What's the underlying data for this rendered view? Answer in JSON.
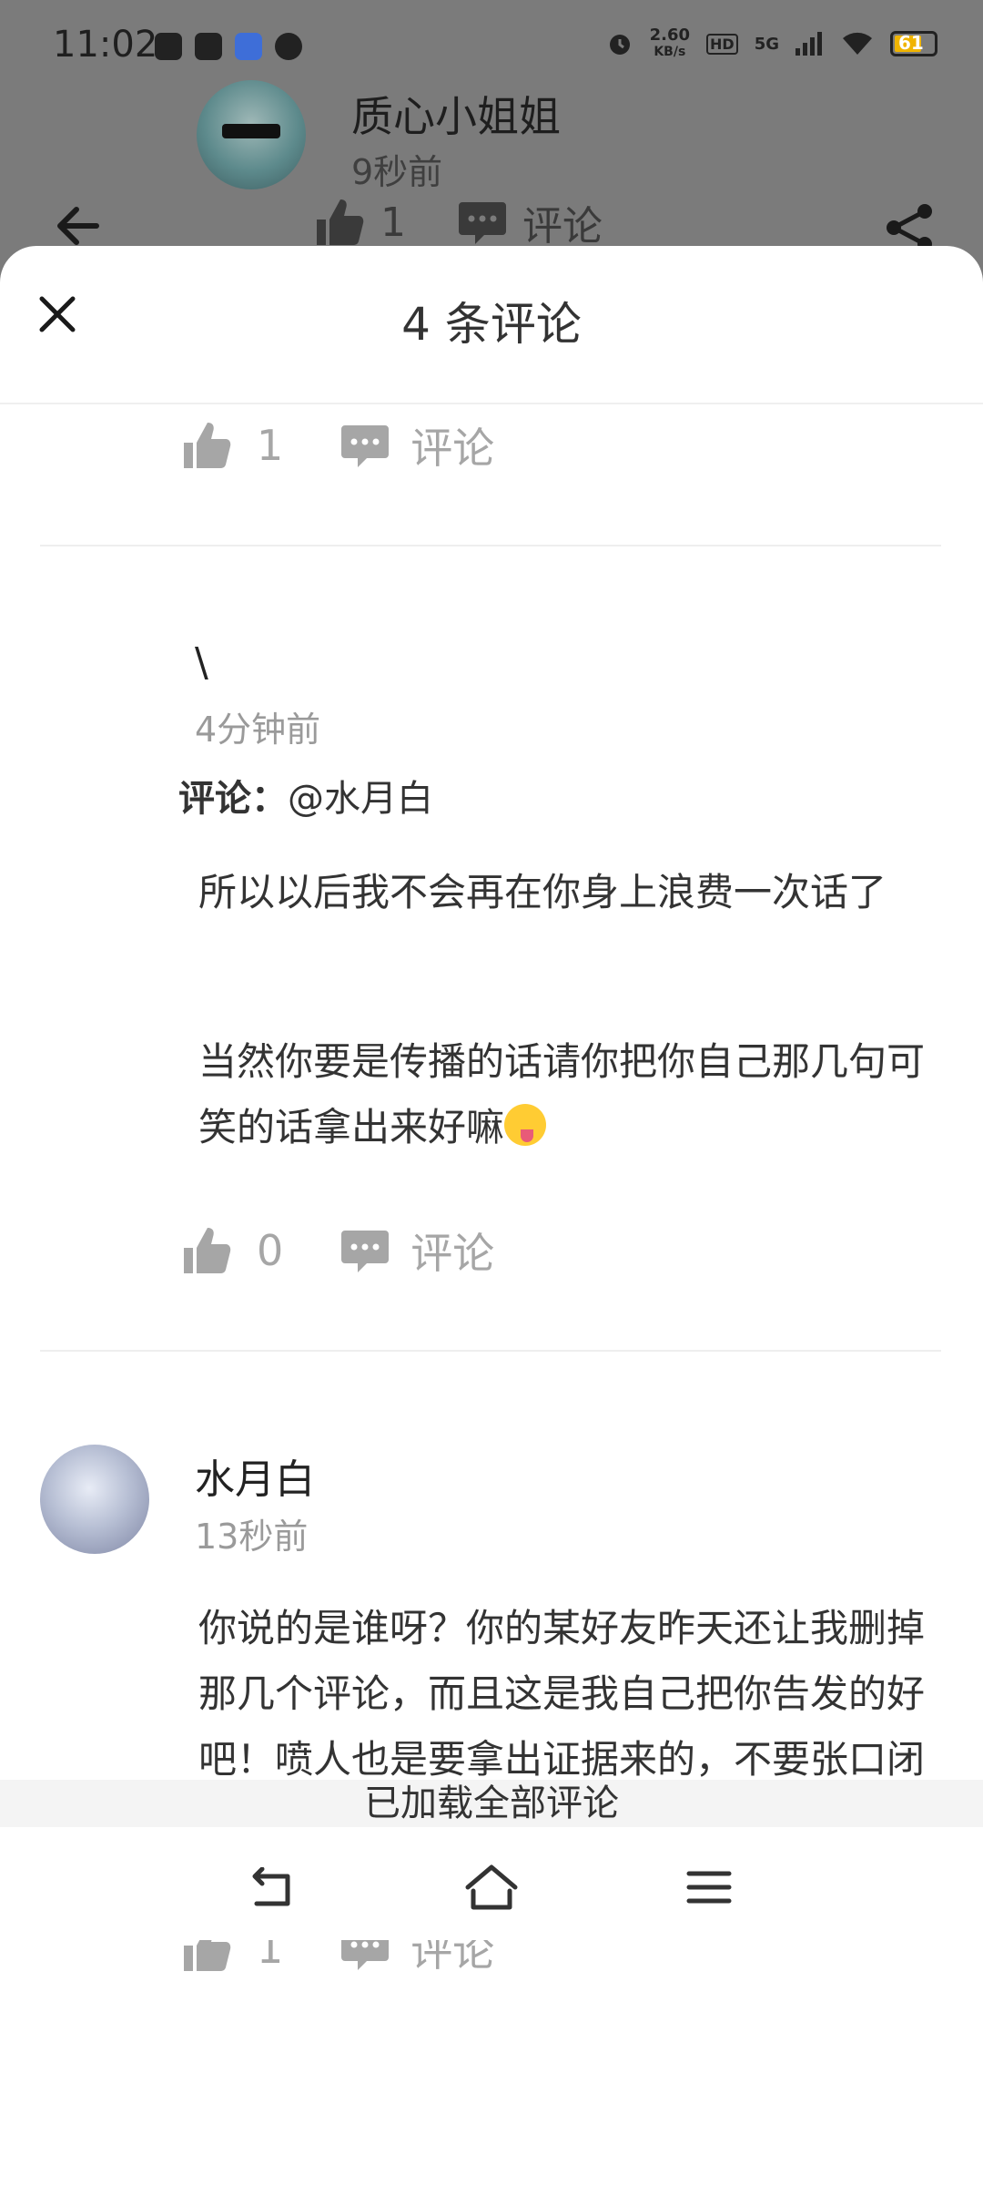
{
  "status_bar": {
    "time": "11:02",
    "net_speed_value": "2.60",
    "net_speed_unit": "KB/s",
    "hd": "HD",
    "network": "5G",
    "battery": "61"
  },
  "post": {
    "author": "质心小姐姐",
    "time": "9秒前",
    "likes": "1",
    "comment_label": "评论"
  },
  "sheet": {
    "title": "4 条评论"
  },
  "top_action": {
    "likes": "1",
    "comment_label": "评论"
  },
  "comments": [
    {
      "name": "\\",
      "time": "4分钟前",
      "reply_prefix": "评论：",
      "reply_target": "@水月白",
      "paragraphs": [
        "所以以后我不会再在你身上浪费一次话了",
        "当然你要是传播的话请你把你自己那几句可笑的话拿出来好嘛"
      ],
      "likes": "0",
      "comment_label": "评论"
    },
    {
      "name": "水月白",
      "time": "13秒前",
      "text": "你说的是谁呀？你的某好友昨天还让我删掉那几个评论，而且这是我自己把你告发的好吧！喷人也是要拿出证据来的，不要张口闭口的就在那信口开河",
      "likes": "1",
      "comment_label": "评论"
    }
  ],
  "footer": {
    "loaded_text": "已加载全部评论"
  },
  "colors": {
    "dim": "#7b7b7b",
    "muted": "#a6a6a6",
    "text": "#333333",
    "divider": "#eeeeee"
  }
}
